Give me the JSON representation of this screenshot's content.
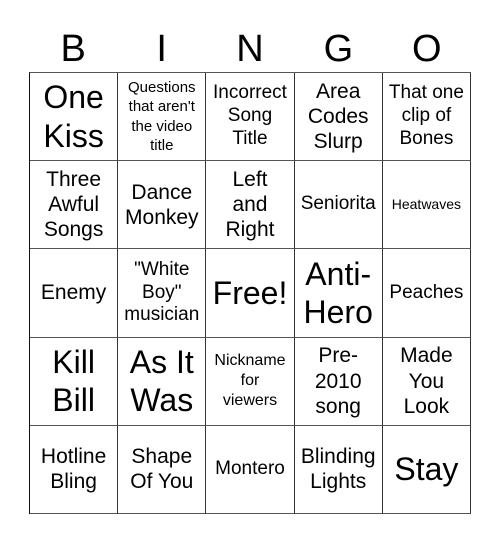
{
  "header": {
    "letters": [
      "B",
      "I",
      "N",
      "G",
      "O"
    ]
  },
  "board": {
    "rows": [
      [
        {
          "lines": [
            "One",
            "Kiss"
          ],
          "size": "xl"
        },
        {
          "lines": [
            "Questions",
            "that aren't",
            "the video",
            "title"
          ],
          "size": "xxs"
        },
        {
          "lines": [
            "Incorrect",
            "Song",
            "Title"
          ],
          "size": "s"
        },
        {
          "lines": [
            "Area",
            "Codes",
            "Slurp"
          ],
          "size": "m"
        },
        {
          "lines": [
            "That one",
            "clip of",
            "Bones"
          ],
          "size": "s"
        }
      ],
      [
        {
          "lines": [
            "Three",
            "Awful",
            "Songs"
          ],
          "size": "m"
        },
        {
          "lines": [
            "Dance",
            "Monkey"
          ],
          "size": "m"
        },
        {
          "lines": [
            "Left",
            "and",
            "Right"
          ],
          "size": "m"
        },
        {
          "lines": [
            "Seniorita"
          ],
          "size": "s"
        },
        {
          "lines": [
            "Heatwaves"
          ],
          "size": "tiny"
        }
      ],
      [
        {
          "lines": [
            "Enemy"
          ],
          "size": "m"
        },
        {
          "lines": [
            "\"White",
            "Boy\"",
            "musician"
          ],
          "size": "s"
        },
        {
          "lines": [
            "Free!"
          ],
          "size": "xl"
        },
        {
          "lines": [
            "Anti-",
            "Hero"
          ],
          "size": "xl"
        },
        {
          "lines": [
            "Peaches"
          ],
          "size": "s"
        }
      ],
      [
        {
          "lines": [
            "Kill",
            "Bill"
          ],
          "size": "xl"
        },
        {
          "lines": [
            "As It",
            "Was"
          ],
          "size": "xl"
        },
        {
          "lines": [
            "Nickname",
            "for",
            "viewers"
          ],
          "size": "xs"
        },
        {
          "lines": [
            "Pre-",
            "2010",
            "song"
          ],
          "size": "m"
        },
        {
          "lines": [
            "Made",
            "You",
            "Look"
          ],
          "size": "m"
        }
      ],
      [
        {
          "lines": [
            "Hotline",
            "Bling"
          ],
          "size": "m"
        },
        {
          "lines": [
            "Shape",
            "Of You"
          ],
          "size": "m"
        },
        {
          "lines": [
            "Montero"
          ],
          "size": "s"
        },
        {
          "lines": [
            "Blinding",
            "Lights"
          ],
          "size": "m"
        },
        {
          "lines": [
            "Stay"
          ],
          "size": "xl"
        }
      ]
    ]
  }
}
